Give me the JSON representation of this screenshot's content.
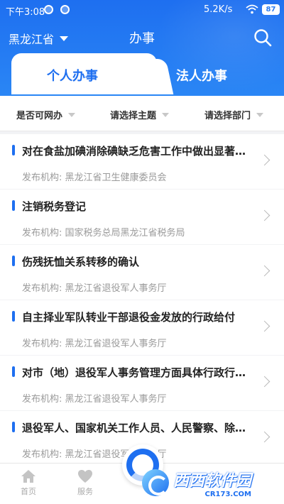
{
  "status_bar": {
    "time": "下午3:08",
    "network_speed": "5.2K/s",
    "battery": "87",
    "icons": [
      "notification-icon",
      "notification-icon",
      "wifi-icon",
      "battery-icon"
    ]
  },
  "header": {
    "province": "黑龙江省",
    "title": "办事",
    "search_icon": "search-icon"
  },
  "tabs": [
    {
      "label": "个人办事",
      "active": true
    },
    {
      "label": "法人办事",
      "active": false
    }
  ],
  "filters": [
    {
      "label": "是否可网办"
    },
    {
      "label": "请选择主题"
    },
    {
      "label": "请选择部门"
    }
  ],
  "items": [
    {
      "name": "对在食盐加碘消除碘缺乏危害工作中做出显著成绩的单位和个人进行表彰奖励",
      "org": "发布机构: 黑龙江省卫生健康委员会"
    },
    {
      "name": "注销税务登记",
      "org": "发布机构: 国家税务总局黑龙江省税务局"
    },
    {
      "name": "伤残抚恤关系转移的确认",
      "org": "发布机构: 黑龙江省退役军人事务厅"
    },
    {
      "name": "自主择业军队转业干部退役金发放的行政给付",
      "org": "发布机构: 黑龙江省退役军人事务厅"
    },
    {
      "name": "对市（地）退役军人事务管理方面具体行政行为的监督",
      "org": "发布机构: 黑龙江省退役军人事务厅"
    },
    {
      "name": "退役军人、国家机关工作人员、人民警察、除外人员抚恤",
      "org": "发布机构: 黑龙江省退役军人事务厅"
    }
  ],
  "bottom_nav": [
    {
      "label": "首页",
      "icon": "home-icon"
    },
    {
      "label": "服务",
      "icon": "heart-icon"
    }
  ],
  "watermark": {
    "main": "西西软件园",
    "url": "CR173.COM"
  },
  "colors": {
    "primary": "#1e6ff0",
    "header_gradient_end": "#2a86f5",
    "muted": "#9a9a9a"
  }
}
